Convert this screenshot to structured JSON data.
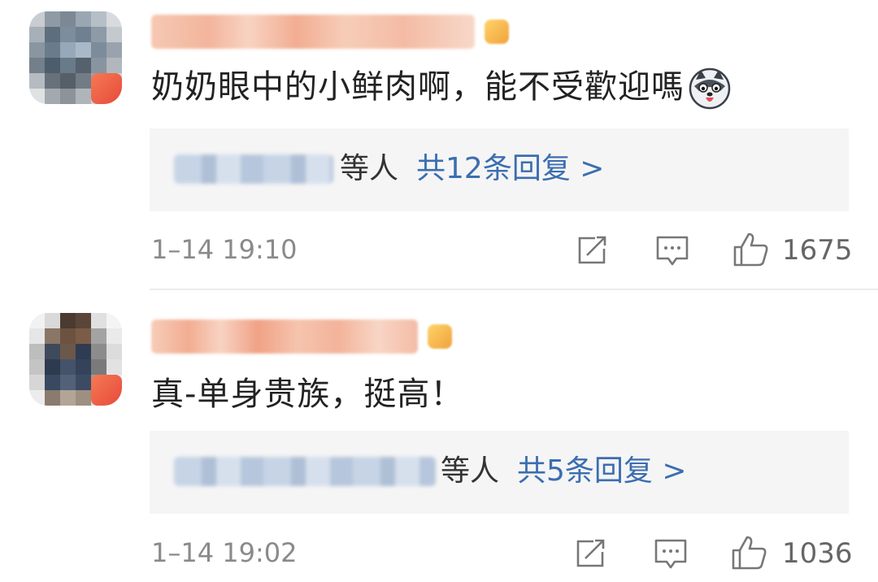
{
  "comments": [
    {
      "text": "奶奶眼中的小鲜肉啊，能不受歡迎嗎",
      "emoji": "husky-dog-emoji-icon",
      "reply_suffix": "等人",
      "reply_link": "共12条回复 >",
      "timestamp": "1–14 19:10",
      "like_count": "1675"
    },
    {
      "text": "真-单身贵族，挺高！",
      "reply_suffix": "等人",
      "reply_link": "共5条回复 >",
      "timestamp": "1–14 19:02",
      "like_count": "1036"
    }
  ],
  "icons": {
    "share": "share-icon",
    "comment": "comment-icon",
    "like": "thumbs-up-icon"
  },
  "colors": {
    "link": "#3b6eb0",
    "reply_box_bg": "#f5f5f5",
    "meta_text": "#8a8a8a"
  }
}
